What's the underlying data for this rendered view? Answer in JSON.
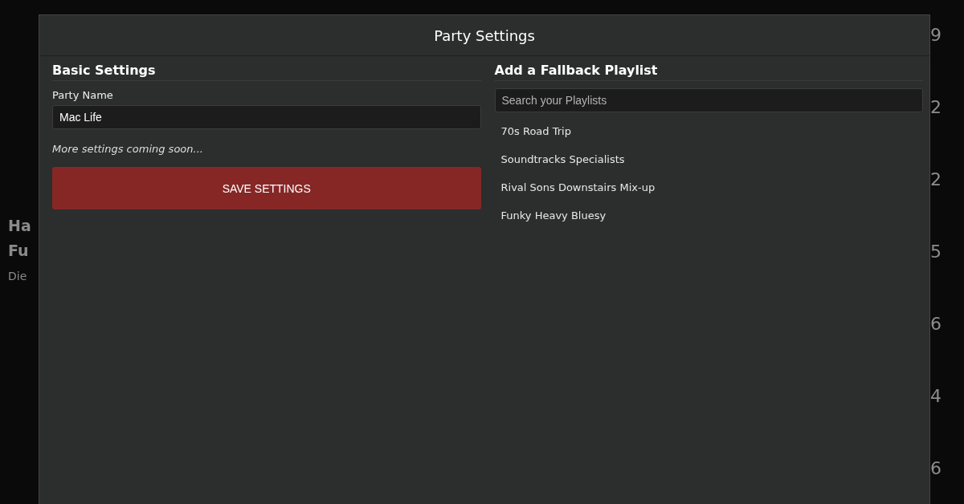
{
  "background": {
    "left_texts": [
      {
        "text": "Ha",
        "kind": "title"
      },
      {
        "text": "Fu",
        "kind": "title"
      },
      {
        "text": "Die",
        "kind": "subtitle"
      }
    ],
    "right_numbers": [
      "9",
      "2",
      "2",
      "5",
      "6",
      "4",
      "6"
    ]
  },
  "dialog": {
    "title": "Party Settings",
    "basic": {
      "heading": "Basic Settings",
      "name_label": "Party Name",
      "name_value": "Mac Life",
      "note": "More settings coming soon...",
      "save_button": "SAVE SETTINGS"
    },
    "fallback": {
      "heading": "Add a Fallback Playlist",
      "search_placeholder": "Search your Playlists",
      "playlists": [
        "70s Road Trip",
        "Soundtracks Specialists",
        "Rival Sons Downstairs Mix-up",
        "Funky Heavy Bluesy"
      ]
    }
  }
}
